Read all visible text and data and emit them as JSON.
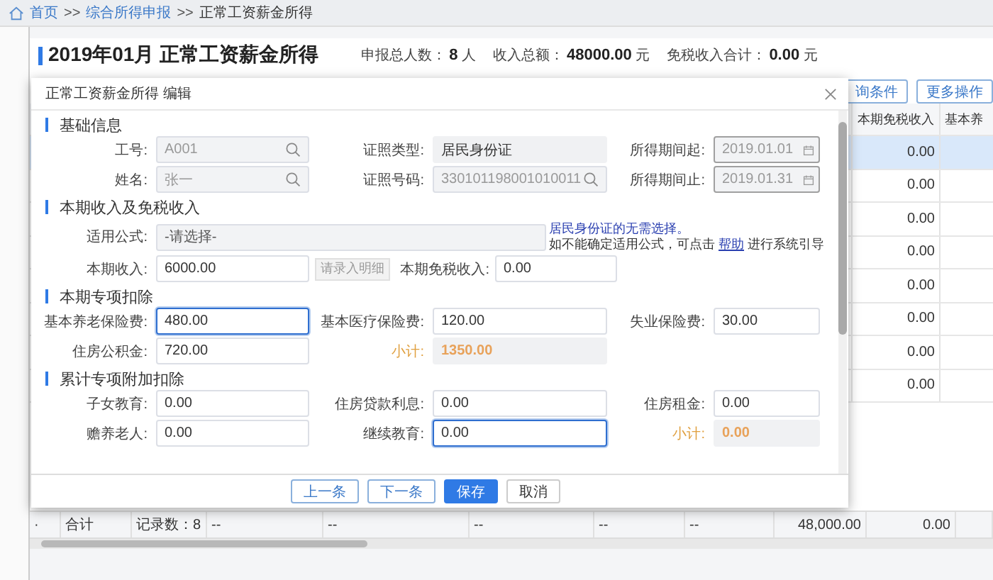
{
  "breadcrumb_separator": ">>",
  "breadcrumb": [
    {
      "text": "首页",
      "link": true
    },
    {
      "text": "综合所得申报",
      "link": true
    },
    {
      "text": "正常工资薪金所得",
      "link": false
    }
  ],
  "header": {
    "title": "2019年01月 正常工资薪金所得",
    "stats": [
      {
        "label": "申报总人数：",
        "value": "8",
        "unit": "人"
      },
      {
        "label": "收入总额：",
        "value": "48000.00",
        "unit": "元"
      },
      {
        "label": "免税收入合计：",
        "value": "0.00",
        "unit": "元"
      }
    ]
  },
  "toolbar": [
    "询条件",
    "更多操作"
  ],
  "table": {
    "columns": [
      "本期免税收入",
      "基本养"
    ],
    "rows": [
      {
        "cells": [
          "0.00",
          ""
        ],
        "selected": true
      },
      {
        "cells": [
          "0.00",
          ""
        ],
        "selected": false
      },
      {
        "cells": [
          "0.00",
          ""
        ],
        "selected": false
      },
      {
        "cells": [
          "0.00",
          ""
        ],
        "selected": false
      },
      {
        "cells": [
          "0.00",
          ""
        ],
        "selected": false
      },
      {
        "cells": [
          "0.00",
          ""
        ],
        "selected": false
      },
      {
        "cells": [
          "0.00",
          ""
        ],
        "selected": false
      },
      {
        "cells": [
          "0.00",
          ""
        ],
        "selected": false
      }
    ],
    "footer": [
      "·",
      "合计",
      "记录数：8",
      "--",
      "--",
      "--",
      "--",
      "--",
      "48,000.00",
      "0.00"
    ]
  },
  "dialog": {
    "title": "正常工资薪金所得 编辑",
    "basic": {
      "title": "基础信息",
      "fields": [
        {
          "label": "工号:",
          "value": "A001",
          "kind": "search"
        },
        {
          "label": "证照类型:",
          "value": "居民身份证",
          "kind": "static"
        },
        {
          "label": "所得期间起:",
          "value": "2019.01.01",
          "kind": "date"
        },
        {
          "label": "姓名:",
          "value": "张一",
          "kind": "search"
        },
        {
          "label": "证照号码:",
          "value": "330101198001010011",
          "kind": "search"
        },
        {
          "label": "所得期间止:",
          "value": "2019.01.31",
          "kind": "date"
        }
      ]
    },
    "income": {
      "title": "本期收入及免税收入",
      "formula_label": "适用公式:",
      "formula_placeholder": "-请选择-",
      "note": "居民身份证的无需选择。",
      "hint_before": "如不能确定适用公式，可点击",
      "hint_link": "帮助",
      "hint_after": "进行系统引导",
      "income_label": "本期收入:",
      "income_value": "6000.00",
      "detail_button": "请录入明细",
      "exempt_label": "本期免税收入:",
      "exempt_value": "0.00"
    },
    "deductions": [
      {
        "title": "本期专项扣除",
        "fields": [
          {
            "label": "基本养老保险费:",
            "value": "480.00",
            "kind": "input",
            "focused": true
          },
          {
            "label": "基本医疗保险费:",
            "value": "120.00",
            "kind": "input",
            "focused": false
          },
          {
            "label": "失业保险费:",
            "value": "30.00",
            "kind": "input",
            "focused": false
          },
          {
            "label": "住房公积金:",
            "value": "720.00",
            "kind": "input",
            "focused": false
          },
          {
            "label": "小计:",
            "value": "1350.00",
            "kind": "subtotal"
          }
        ]
      },
      {
        "title": "累计专项附加扣除",
        "fields": [
          {
            "label": "子女教育:",
            "value": "0.00",
            "kind": "input",
            "focused": false
          },
          {
            "label": "住房贷款利息:",
            "value": "0.00",
            "kind": "input",
            "focused": false
          },
          {
            "label": "住房租金:",
            "value": "0.00",
            "kind": "input",
            "focused": false
          },
          {
            "label": "赡养老人:",
            "value": "0.00",
            "kind": "input",
            "focused": false
          },
          {
            "label": "继续教育:",
            "value": "0.00",
            "kind": "input",
            "focused": true
          },
          {
            "label": "小计:",
            "value": "0.00",
            "kind": "subtotal"
          }
        ]
      }
    ],
    "buttons": [
      {
        "label": "上一条",
        "kind": "outline"
      },
      {
        "label": "下一条",
        "kind": "outline"
      },
      {
        "label": "保存",
        "kind": "primary"
      },
      {
        "label": "取消",
        "kind": "plain"
      }
    ]
  }
}
